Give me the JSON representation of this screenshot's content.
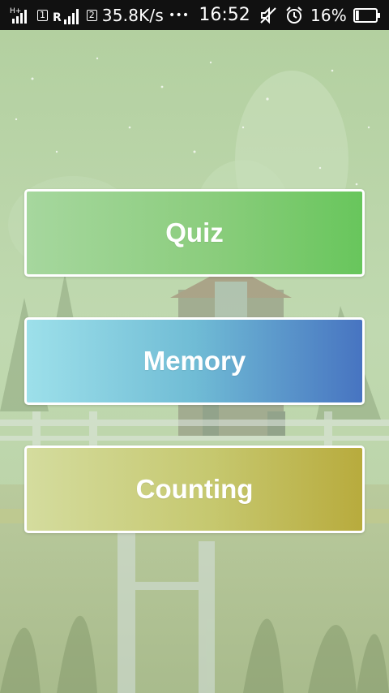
{
  "status_bar": {
    "network_type": "H+",
    "sim1_badge": "1",
    "roaming_label": "R",
    "sim2_badge": "2",
    "net_speed": "35.8K/s",
    "more_indicator": "•••",
    "time": "16:52",
    "battery_percent": "16%",
    "battery_level": 0.16,
    "icons": [
      "signal-icon",
      "signal-roaming-icon",
      "mute-icon",
      "alarm-icon",
      "battery-icon"
    ]
  },
  "menu": {
    "quiz_label": "Quiz",
    "memory_label": "Memory",
    "counting_label": "Counting"
  },
  "colors": {
    "quiz_gradient": [
      "#a6d79e",
      "#68c65c"
    ],
    "memory_gradient": [
      "#9de0ea",
      "#4774c1"
    ],
    "counting_gradient": [
      "#d4dc9e",
      "#b8ab3d"
    ],
    "status_bar_bg": "#111111"
  }
}
